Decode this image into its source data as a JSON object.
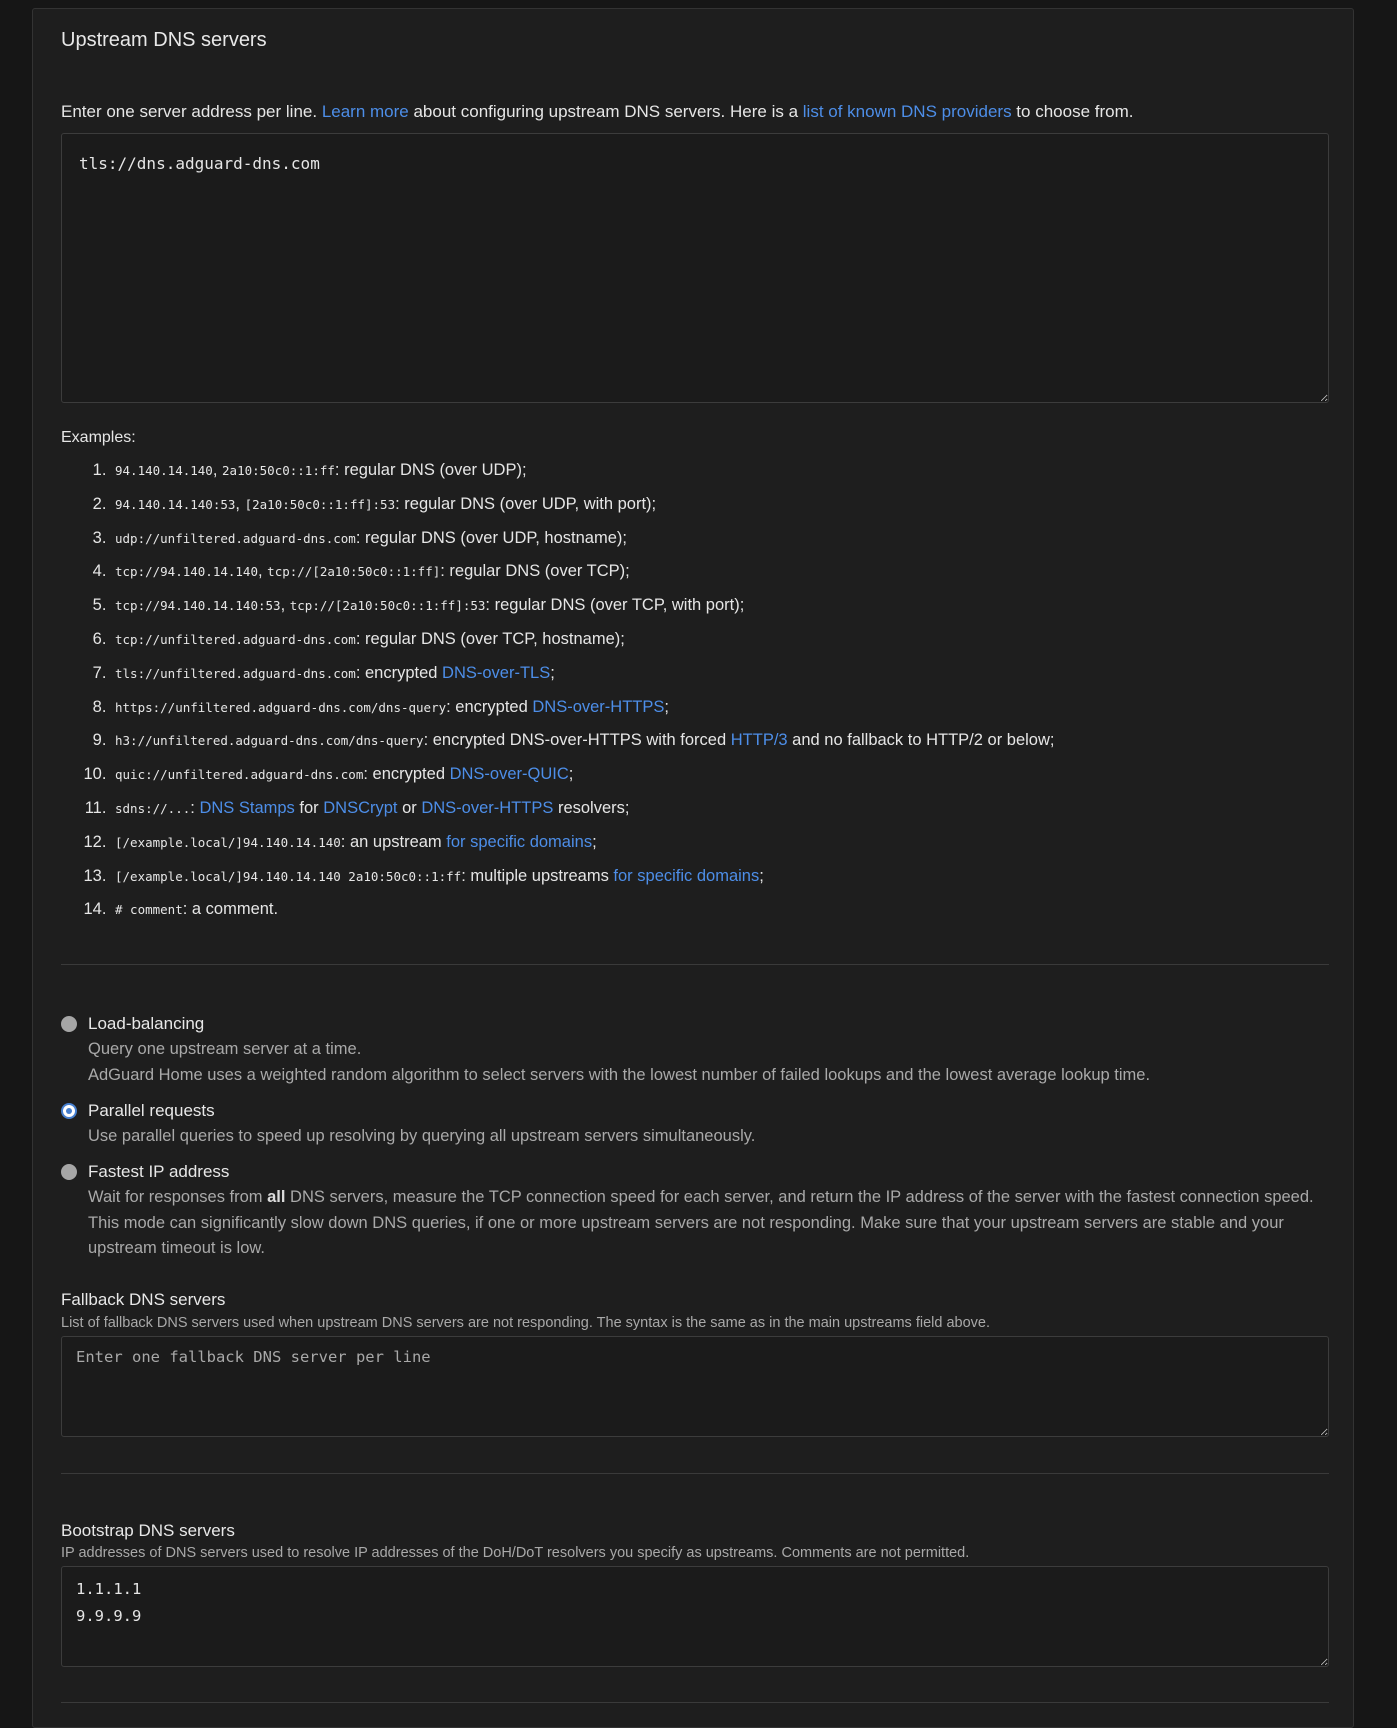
{
  "upstream": {
    "title": "Upstream DNS servers",
    "desc_1": "Enter one server address per line. ",
    "learn_more": "Learn more",
    "desc_2": " about configuring upstream DNS servers. Here is a ",
    "providers_link": "list of known DNS providers",
    "desc_3": " to choose from.",
    "value": "tls://dns.adguard-dns.com"
  },
  "examples": {
    "title": "Examples:",
    "items": [
      {
        "code_1": "94.140.14.140",
        "sep": ", ",
        "code_2": "2a10:50c0::1:ff",
        "text": ": regular DNS (over UDP);"
      },
      {
        "code_1": "94.140.14.140:53",
        "sep": ", ",
        "code_2": "[2a10:50c0::1:ff]:53",
        "text": ": regular DNS (over UDP, with port);"
      },
      {
        "code_1": "udp://unfiltered.adguard-dns.com",
        "text": ": regular DNS (over UDP, hostname);"
      },
      {
        "code_1": "tcp://94.140.14.140",
        "sep": ", ",
        "code_2": "tcp://[2a10:50c0::1:ff]",
        "text": ": regular DNS (over TCP);"
      },
      {
        "code_1": "tcp://94.140.14.140:53",
        "sep": ", ",
        "code_2": "tcp://[2a10:50c0::1:ff]:53",
        "text": ": regular DNS (over TCP, with port);"
      },
      {
        "code_1": "tcp://unfiltered.adguard-dns.com",
        "text": ": regular DNS (over TCP, hostname);"
      },
      {
        "code_1": "tls://unfiltered.adguard-dns.com",
        "text": ": encrypted ",
        "link_1": "DNS-over-TLS",
        "tail": ";"
      },
      {
        "code_1": "https://unfiltered.adguard-dns.com/dns-query",
        "text": ": encrypted ",
        "link_1": "DNS-over-HTTPS",
        "tail": ";"
      },
      {
        "code_1": "h3://unfiltered.adguard-dns.com/dns-query",
        "text": ": encrypted DNS-over-HTTPS with forced ",
        "link_1": "HTTP/3",
        "tail": " and no fallback to HTTP/2 or below;"
      },
      {
        "code_1": "quic://unfiltered.adguard-dns.com",
        "text": ": encrypted ",
        "link_1": "DNS-over-QUIC",
        "tail": ";"
      },
      {
        "code_1": "sdns://...",
        "text": ": ",
        "link_1": "DNS Stamps",
        "mid_1": " for ",
        "link_2": "DNSCrypt",
        "mid_2": " or ",
        "link_3": "DNS-over-HTTPS",
        "tail": " resolvers;"
      },
      {
        "code_1": "[/example.local/]94.140.14.140",
        "text": ": an upstream ",
        "link_1": "for specific domains",
        "tail": ";"
      },
      {
        "code_1": "[/example.local/]94.140.14.140 2a10:50c0::1:ff",
        "text": ": multiple upstreams ",
        "link_1": "for specific domains",
        "tail": ";"
      },
      {
        "code_1": "# comment",
        "text": ": a comment."
      }
    ]
  },
  "modes": {
    "load_balancing": {
      "label": "Load-balancing",
      "desc_1": "Query one upstream server at a time.",
      "desc_2": "AdGuard Home uses a weighted random algorithm to select servers with the lowest number of failed lookups and the lowest average lookup time."
    },
    "parallel": {
      "label": "Parallel requests",
      "desc": "Use parallel queries to speed up resolving by querying all upstream servers simultaneously."
    },
    "fastest": {
      "label": "Fastest IP address",
      "desc_pre": "Wait for responses from ",
      "desc_bold": "all",
      "desc_post": " DNS servers, measure the TCP connection speed for each server, and return the IP address of the server with the fastest connection speed. This mode can significantly slow down DNS queries, if one or more upstream servers are not responding. Make sure that your upstream servers are stable and your upstream timeout is low."
    },
    "selected": "parallel",
    "accent_color": "#467fcf"
  },
  "fallback": {
    "title": "Fallback DNS servers",
    "subtitle": "List of fallback DNS servers used when upstream DNS servers are not responding. The syntax is the same as in the main upstreams field above.",
    "placeholder": "Enter one fallback DNS server per line",
    "value": ""
  },
  "bootstrap": {
    "title": "Bootstrap DNS servers",
    "subtitle": "IP addresses of DNS servers used to resolve IP addresses of the DoH/DoT resolvers you specify as upstreams. Comments are not permitted.",
    "value": "1.1.1.1\n9.9.9.9"
  }
}
